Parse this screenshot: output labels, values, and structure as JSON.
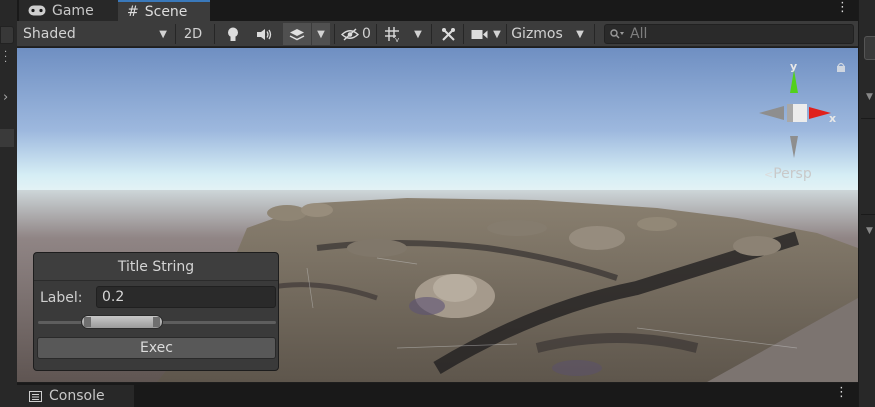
{
  "tabs": [
    {
      "label": "Game",
      "icon": "gamepad-icon",
      "active": false
    },
    {
      "label": "Scene",
      "icon": "grid-hash-icon",
      "active": true
    }
  ],
  "toolbar": {
    "draw_mode": "Shaded",
    "mode_2d": "2D",
    "hidden_count": "0",
    "gizmos": "Gizmos",
    "search_placeholder": "All"
  },
  "viewport": {
    "projection": "Persp",
    "axis_x": "x",
    "axis_y": "y",
    "sky_color": "#7592c4",
    "horizon_color": "#d6eef5",
    "ground_color": "#5f5552"
  },
  "panel": {
    "title": "Title String",
    "field_label": "Label:",
    "field_value": "0.2",
    "exec_label": "Exec"
  },
  "console": {
    "label": "Console"
  },
  "colors": {
    "accent": "#3a79bb",
    "axis_x": "#e0201b",
    "axis_y": "#52d11b"
  }
}
